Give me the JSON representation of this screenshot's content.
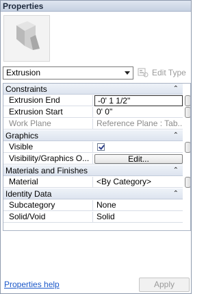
{
  "window": {
    "title": "Properties"
  },
  "preview": {
    "icon": "extrusion-3d-icon"
  },
  "type_selector": {
    "selected": "Extrusion",
    "edit_type_label": "Edit Type",
    "edit_type_icon": "edit-type-icon"
  },
  "grid": {
    "collapse_glyph": "⌃",
    "categories": [
      {
        "label": "Constraints",
        "rows": [
          {
            "name": "Extrusion End",
            "value": "-0'  1 1/2\""
          },
          {
            "name": "Extrusion Start",
            "value": "0'  0\""
          },
          {
            "name": "Work Plane",
            "value": "Reference Plane : Tab..."
          }
        ]
      },
      {
        "label": "Graphics",
        "rows": [
          {
            "name": "Visible",
            "value": ""
          },
          {
            "name": "Visibility/Graphics O...",
            "value": "Edit..."
          }
        ]
      },
      {
        "label": "Materials and Finishes",
        "rows": [
          {
            "name": "Material",
            "value": "<By Category>"
          }
        ]
      },
      {
        "label": "Identity Data",
        "rows": [
          {
            "name": "Subcategory",
            "value": "None"
          },
          {
            "name": "Solid/Void",
            "value": "Solid"
          }
        ]
      }
    ]
  },
  "footer": {
    "help_link": "Properties help",
    "apply_label": "Apply"
  }
}
